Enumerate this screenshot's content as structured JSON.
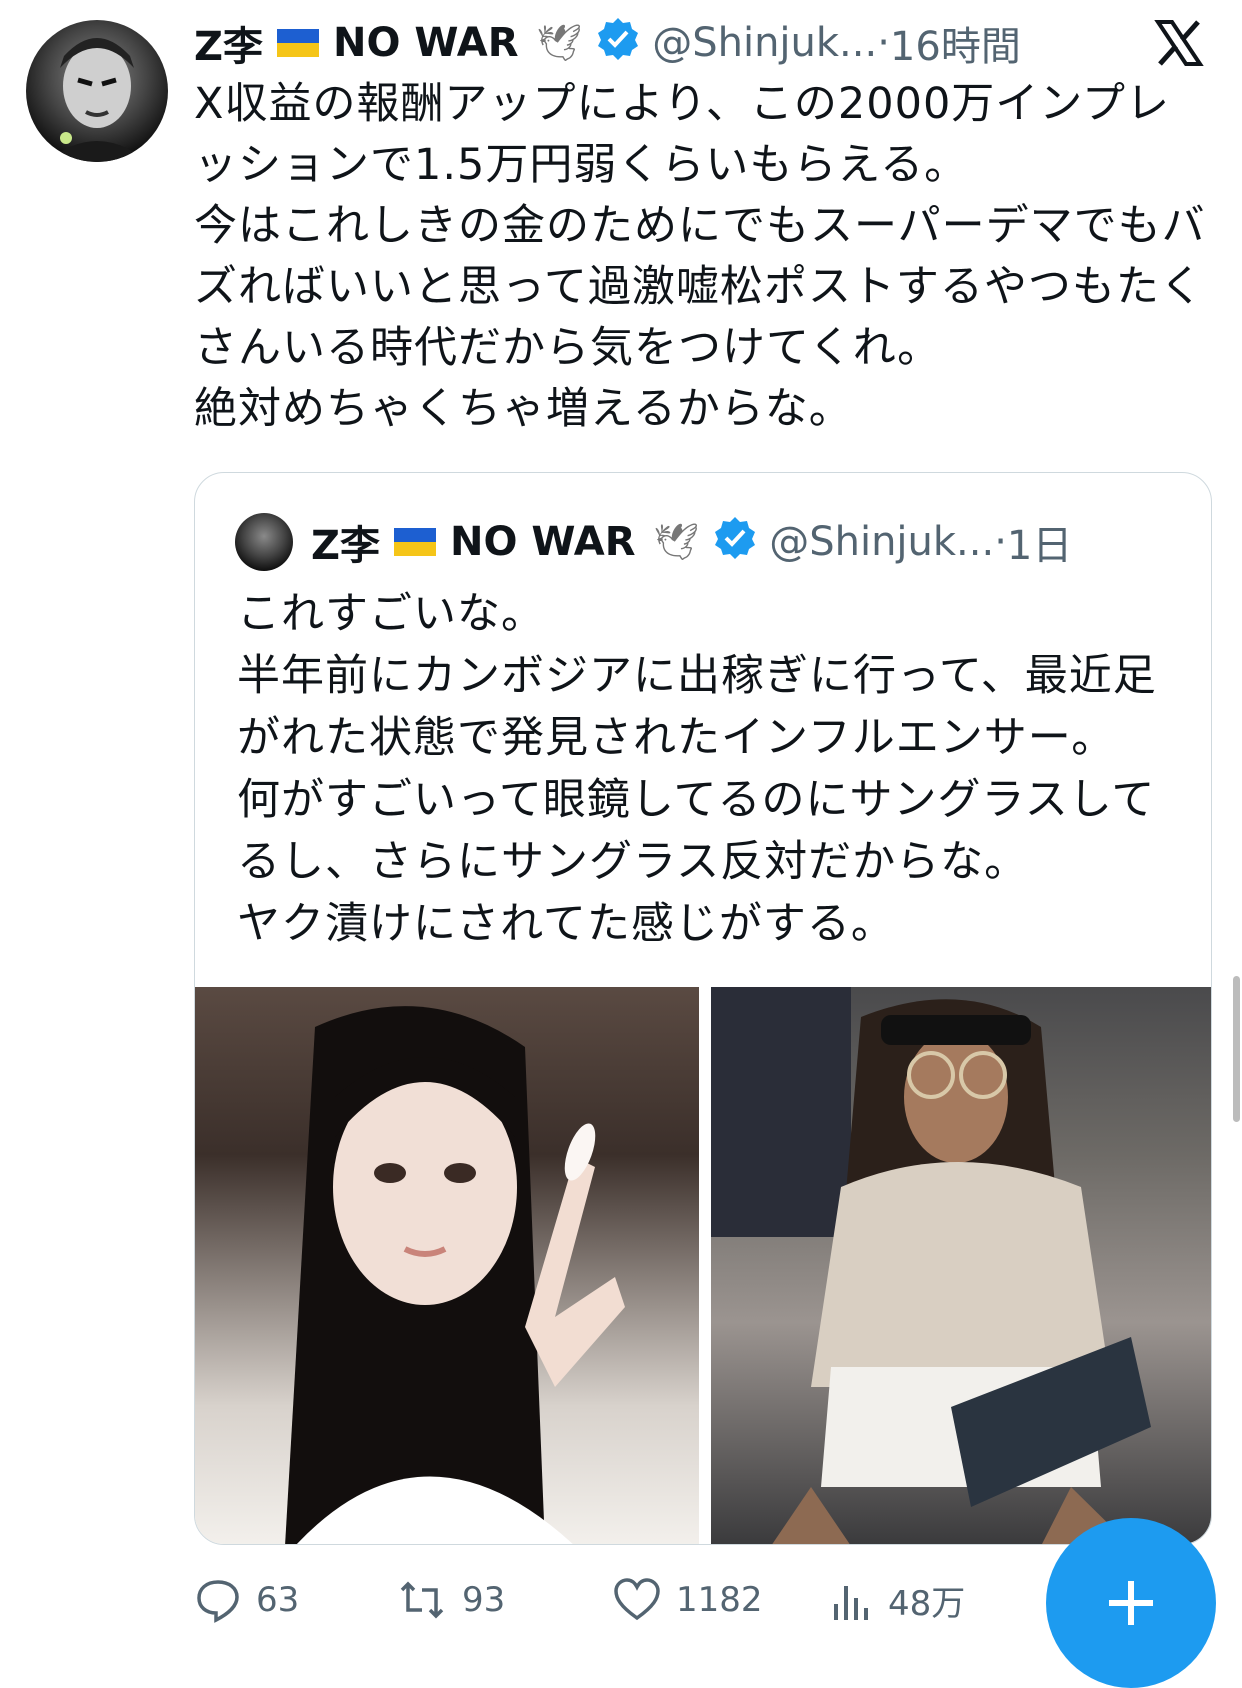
{
  "tweet": {
    "author_name": "Z李",
    "name_suffix": "NO WAR",
    "dove_icon": "dove-icon",
    "handle": "@Shinjuk...",
    "time": "16時間",
    "body": "X収益の報酬アップにより、この2000万インプレッションで1.5万円弱くらいもらえる。\n今はこれしきの金のためにでもスーパーデマでもバズればいいと思って過激嘘松ポストするやつもたくさんいる時代だから気をつけてくれ。\n絶対めちゃくちゃ増えるからな。"
  },
  "quote": {
    "author_name": "Z李",
    "name_suffix": "NO WAR",
    "handle": "@Shinjuk...",
    "time": "1日",
    "body": "これすごいな。\n半年前にカンボジアに出稼ぎに行って、最近足がれた状態で発見されたインフルエンサー。\n何がすごいって眼鏡してるのにサングラスしてるし、さらにサングラス反対だからな。\nヤク漬けにされてた感じがする。"
  },
  "actions": {
    "replies": "63",
    "reposts": "93",
    "likes": "1182",
    "views": "48万"
  },
  "colors": {
    "accent": "#1d9bf0",
    "secondary_text": "#536471",
    "border": "#cfd9de"
  }
}
